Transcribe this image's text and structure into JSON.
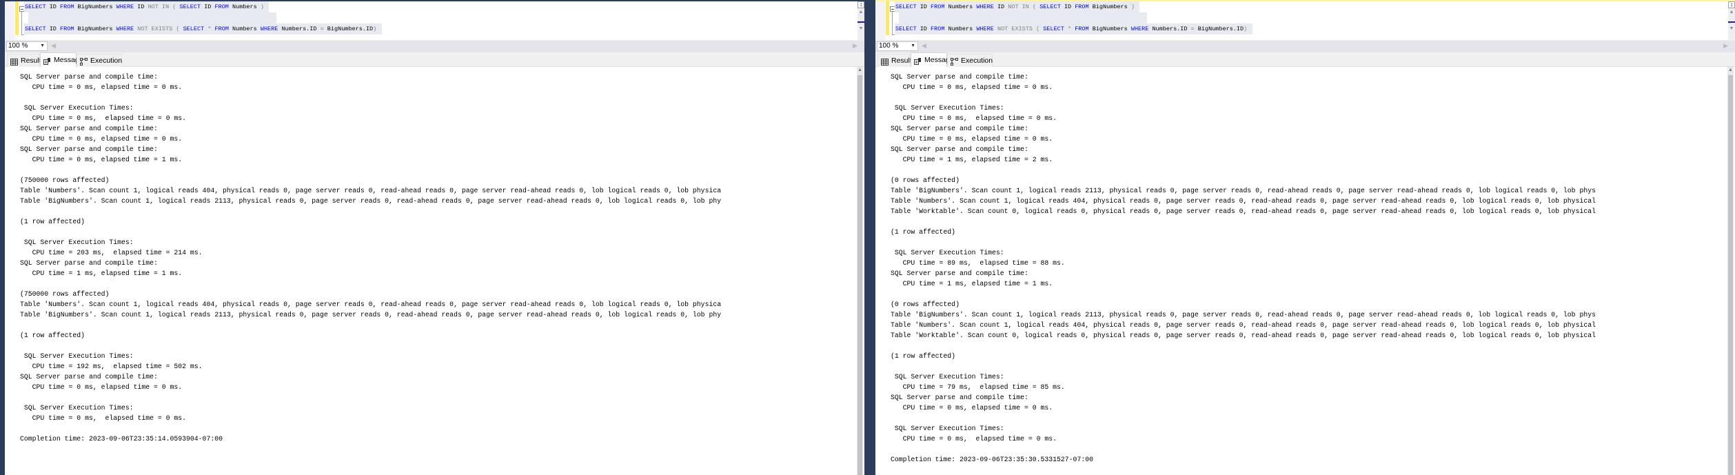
{
  "panes": [
    {
      "code_lines": [
        [
          [
            "SELECT",
            "kw"
          ],
          [
            " ID ",
            "id"
          ],
          [
            "FROM",
            "kw"
          ],
          [
            " BigNumbers ",
            "id"
          ],
          [
            "WHERE",
            "kw"
          ],
          [
            " ID ",
            "id"
          ],
          [
            "NOT IN ( ",
            "op"
          ],
          [
            "SELECT",
            "kw"
          ],
          [
            " ID ",
            "id"
          ],
          [
            "FROM",
            "kw"
          ],
          [
            " Numbers ",
            "id"
          ],
          [
            ")",
            "op"
          ]
        ],
        [],
        [
          [
            "SELECT",
            "kw"
          ],
          [
            " ID ",
            "id"
          ],
          [
            "FROM",
            "kw"
          ],
          [
            " BigNumbers ",
            "id"
          ],
          [
            "WHERE",
            "kw"
          ],
          [
            " ",
            "id"
          ],
          [
            "NOT EXISTS ( ",
            "op"
          ],
          [
            "SELECT",
            "kw"
          ],
          [
            " ",
            "id"
          ],
          [
            "*",
            "op"
          ],
          [
            " ",
            "id"
          ],
          [
            "FROM",
            "kw"
          ],
          [
            " Numbers ",
            "id"
          ],
          [
            "WHERE",
            "kw"
          ],
          [
            " Numbers.ID ",
            "id"
          ],
          [
            "=",
            "op"
          ],
          [
            " BigNumbers.ID",
            "id"
          ],
          [
            ")",
            "op"
          ]
        ]
      ],
      "zoom": "100 %",
      "tabs": [
        {
          "label": "Results",
          "icon": "grid-icon"
        },
        {
          "label": "Messages",
          "icon": "messages-icon",
          "active": true
        },
        {
          "label": "Execution plan",
          "icon": "execution-plan-icon"
        }
      ],
      "messages": [
        "SQL Server parse and compile time: ",
        "   CPU time = 0 ms, elapsed time = 0 ms.",
        "",
        " SQL Server Execution Times:",
        "   CPU time = 0 ms,  elapsed time = 0 ms.",
        "SQL Server parse and compile time: ",
        "   CPU time = 0 ms, elapsed time = 0 ms.",
        "SQL Server parse and compile time: ",
        "   CPU time = 0 ms, elapsed time = 1 ms.",
        "",
        "(750000 rows affected)",
        "Table 'Numbers'. Scan count 1, logical reads 404, physical reads 0, page server reads 0, read-ahead reads 0, page server read-ahead reads 0, lob logical reads 0, lob physica",
        "Table 'BigNumbers'. Scan count 1, logical reads 2113, physical reads 0, page server reads 0, read-ahead reads 0, page server read-ahead reads 0, lob logical reads 0, lob phy",
        "",
        "(1 row affected)",
        "",
        " SQL Server Execution Times:",
        "   CPU time = 203 ms,  elapsed time = 214 ms.",
        "SQL Server parse and compile time: ",
        "   CPU time = 1 ms, elapsed time = 1 ms.",
        "",
        "(750000 rows affected)",
        "Table 'Numbers'. Scan count 1, logical reads 404, physical reads 0, page server reads 0, read-ahead reads 0, page server read-ahead reads 0, lob logical reads 0, lob physica",
        "Table 'BigNumbers'. Scan count 1, logical reads 2113, physical reads 0, page server reads 0, read-ahead reads 0, page server read-ahead reads 0, lob logical reads 0, lob phy",
        "",
        "(1 row affected)",
        "",
        " SQL Server Execution Times:",
        "   CPU time = 192 ms,  elapsed time = 502 ms.",
        "SQL Server parse and compile time: ",
        "   CPU time = 0 ms, elapsed time = 0 ms.",
        "",
        " SQL Server Execution Times:",
        "   CPU time = 0 ms,  elapsed time = 0 ms.",
        "",
        "Completion time: 2023-09-06T23:35:14.0593904-07:00"
      ]
    },
    {
      "code_lines": [
        [
          [
            "SELECT",
            "kw"
          ],
          [
            " ID ",
            "id"
          ],
          [
            "FROM",
            "kw"
          ],
          [
            " Numbers ",
            "id"
          ],
          [
            "WHERE",
            "kw"
          ],
          [
            " ID ",
            "id"
          ],
          [
            "NOT IN ( ",
            "op"
          ],
          [
            "SELECT",
            "kw"
          ],
          [
            " ID ",
            "id"
          ],
          [
            "FROM",
            "kw"
          ],
          [
            " BigNumbers ",
            "id"
          ],
          [
            ")",
            "op"
          ]
        ],
        [],
        [
          [
            "SELECT",
            "kw"
          ],
          [
            " ID ",
            "id"
          ],
          [
            "FROM",
            "kw"
          ],
          [
            " Numbers ",
            "id"
          ],
          [
            "WHERE",
            "kw"
          ],
          [
            " ",
            "id"
          ],
          [
            "NOT EXISTS ( ",
            "op"
          ],
          [
            "SELECT",
            "kw"
          ],
          [
            " ",
            "id"
          ],
          [
            "*",
            "op"
          ],
          [
            " ",
            "id"
          ],
          [
            "FROM",
            "kw"
          ],
          [
            " BigNumbers ",
            "id"
          ],
          [
            "WHERE",
            "kw"
          ],
          [
            " Numbers.ID ",
            "id"
          ],
          [
            "=",
            "op"
          ],
          [
            " BigNumbers.ID",
            "id"
          ],
          [
            ")",
            "op"
          ]
        ]
      ],
      "zoom": "100 %",
      "tabs": [
        {
          "label": "Results",
          "icon": "grid-icon"
        },
        {
          "label": "Messages",
          "icon": "messages-icon",
          "active": true
        },
        {
          "label": "Execution plan",
          "icon": "execution-plan-icon"
        }
      ],
      "messages": [
        "SQL Server parse and compile time: ",
        "   CPU time = 0 ms, elapsed time = 0 ms.",
        "",
        " SQL Server Execution Times:",
        "   CPU time = 0 ms,  elapsed time = 0 ms.",
        "SQL Server parse and compile time: ",
        "   CPU time = 0 ms, elapsed time = 0 ms.",
        "SQL Server parse and compile time: ",
        "   CPU time = 1 ms, elapsed time = 2 ms.",
        "",
        "(0 rows affected)",
        "Table 'BigNumbers'. Scan count 1, logical reads 2113, physical reads 0, page server reads 0, read-ahead reads 0, page server read-ahead reads 0, lob logical reads 0, lob phys",
        "Table 'Numbers'. Scan count 1, logical reads 404, physical reads 0, page server reads 0, read-ahead reads 0, page server read-ahead reads 0, lob logical reads 0, lob physical",
        "Table 'Worktable'. Scan count 0, logical reads 0, physical reads 0, page server reads 0, read-ahead reads 0, page server read-ahead reads 0, lob logical reads 0, lob physical",
        "",
        "(1 row affected)",
        "",
        " SQL Server Execution Times:",
        "   CPU time = 89 ms,  elapsed time = 88 ms.",
        "SQL Server parse and compile time: ",
        "   CPU time = 1 ms, elapsed time = 1 ms.",
        "",
        "(0 rows affected)",
        "Table 'BigNumbers'. Scan count 1, logical reads 2113, physical reads 0, page server reads 0, read-ahead reads 0, page server read-ahead reads 0, lob logical reads 0, lob phys",
        "Table 'Numbers'. Scan count 1, logical reads 404, physical reads 0, page server reads 0, read-ahead reads 0, page server read-ahead reads 0, lob logical reads 0, lob physical",
        "Table 'Worktable'. Scan count 0, logical reads 0, physical reads 0, page server reads 0, read-ahead reads 0, page server read-ahead reads 0, lob logical reads 0, lob physical",
        "",
        "(1 row affected)",
        "",
        " SQL Server Execution Times:",
        "   CPU time = 79 ms,  elapsed time = 85 ms.",
        "SQL Server parse and compile time: ",
        "   CPU time = 0 ms, elapsed time = 0 ms.",
        "",
        " SQL Server Execution Times:",
        "   CPU time = 0 ms,  elapsed time = 0 ms.",
        "",
        "Completion time: 2023-09-06T23:35:30.5331527-07:00"
      ]
    }
  ]
}
